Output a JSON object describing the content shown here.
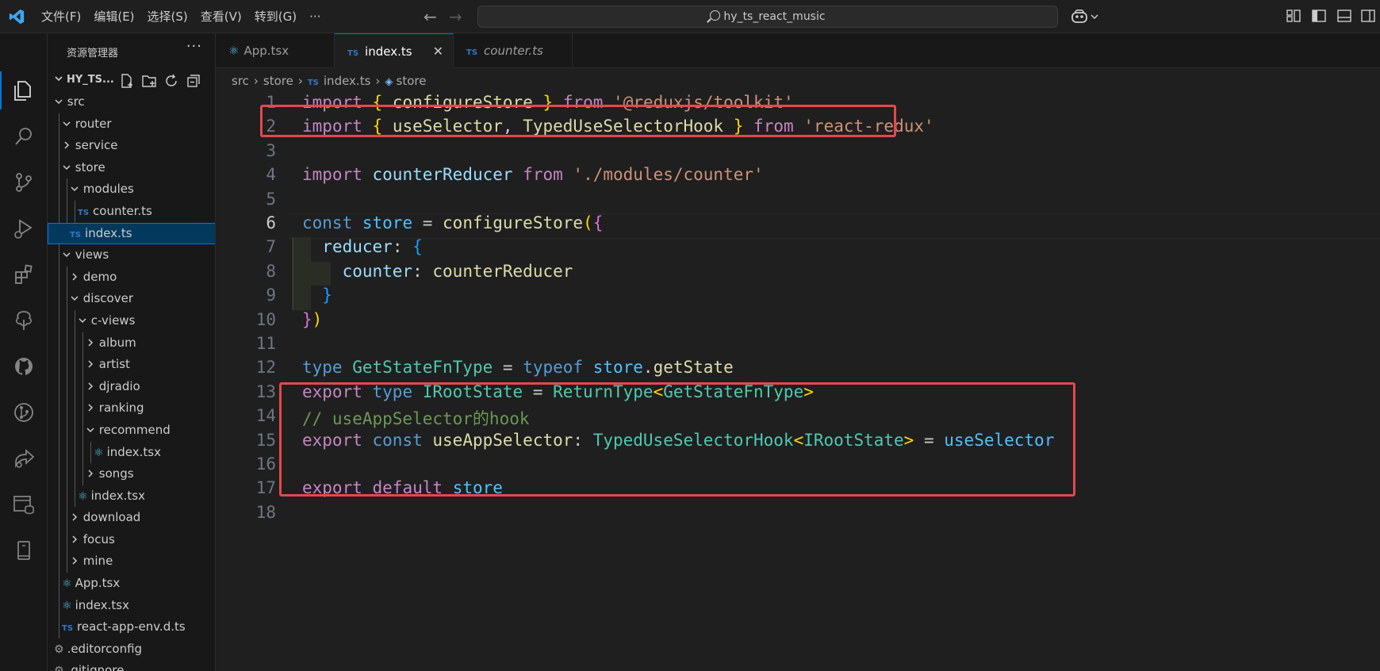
{
  "titlebar": {
    "menu": [
      "文件(F)",
      "编辑(E)",
      "选择(S)",
      "查看(V)",
      "转到(G)",
      "···"
    ],
    "search": "hy_ts_react_music"
  },
  "sidebar": {
    "title": "资源管理器",
    "more": "···",
    "root": "HY_TS...",
    "items": [
      {
        "label": "src",
        "depth": 0,
        "kind": "folder-open"
      },
      {
        "label": "router",
        "depth": 1,
        "kind": "folder-open"
      },
      {
        "label": "service",
        "depth": 1,
        "kind": "folder-closed"
      },
      {
        "label": "store",
        "depth": 1,
        "kind": "folder-open"
      },
      {
        "label": "modules",
        "depth": 2,
        "kind": "folder-open"
      },
      {
        "label": "counter.ts",
        "depth": 3,
        "kind": "ts"
      },
      {
        "label": "index.ts",
        "depth": 2,
        "kind": "ts",
        "selected": true
      },
      {
        "label": "views",
        "depth": 1,
        "kind": "folder-open"
      },
      {
        "label": "demo",
        "depth": 2,
        "kind": "folder-closed"
      },
      {
        "label": "discover",
        "depth": 2,
        "kind": "folder-open"
      },
      {
        "label": "c-views",
        "depth": 3,
        "kind": "folder-open"
      },
      {
        "label": "album",
        "depth": 4,
        "kind": "folder-closed"
      },
      {
        "label": "artist",
        "depth": 4,
        "kind": "folder-closed"
      },
      {
        "label": "djradio",
        "depth": 4,
        "kind": "folder-closed"
      },
      {
        "label": "ranking",
        "depth": 4,
        "kind": "folder-closed"
      },
      {
        "label": "recommend",
        "depth": 4,
        "kind": "folder-open"
      },
      {
        "label": "index.tsx",
        "depth": 5,
        "kind": "react"
      },
      {
        "label": "songs",
        "depth": 4,
        "kind": "folder-closed"
      },
      {
        "label": "index.tsx",
        "depth": 3,
        "kind": "react"
      },
      {
        "label": "download",
        "depth": 2,
        "kind": "folder-closed"
      },
      {
        "label": "focus",
        "depth": 2,
        "kind": "folder-closed"
      },
      {
        "label": "mine",
        "depth": 2,
        "kind": "folder-closed"
      },
      {
        "label": "App.tsx",
        "depth": 1,
        "kind": "react"
      },
      {
        "label": "index.tsx",
        "depth": 1,
        "kind": "react"
      },
      {
        "label": "react-app-env.d.ts",
        "depth": 1,
        "kind": "ts"
      },
      {
        "label": ".editorconfig",
        "depth": 0,
        "kind": "gear"
      },
      {
        "label": ".gitignore",
        "depth": 0,
        "kind": "gear"
      }
    ]
  },
  "tabs": [
    {
      "label": "App.tsx",
      "kind": "react",
      "active": false,
      "italic": false
    },
    {
      "label": "index.ts",
      "kind": "ts",
      "active": true,
      "italic": false,
      "close": "✕"
    },
    {
      "label": "counter.ts",
      "kind": "ts",
      "active": false,
      "italic": true
    }
  ],
  "breadcrumb": [
    "src",
    "store",
    "index.ts",
    "store"
  ],
  "ts_badge": "TS",
  "editor": {
    "current_line": 6,
    "lines": [
      [
        [
          "kw",
          "import"
        ],
        [
          "pl",
          " "
        ],
        [
          "br1",
          "{"
        ],
        [
          "pl",
          " "
        ],
        [
          "fn",
          "configureStore"
        ],
        [
          "pl",
          " "
        ],
        [
          "br1",
          "}"
        ],
        [
          "pl",
          " "
        ],
        [
          "kw",
          "from"
        ],
        [
          "pl",
          " "
        ],
        [
          "str",
          "'@reduxjs/toolkit'"
        ]
      ],
      [
        [
          "kw",
          "import"
        ],
        [
          "pl",
          " "
        ],
        [
          "br1",
          "{"
        ],
        [
          "pl",
          " "
        ],
        [
          "fn",
          "useSelector"
        ],
        [
          "pl",
          ", "
        ],
        [
          "fn",
          "TypedUseSelectorHook"
        ],
        [
          "pl",
          " "
        ],
        [
          "br1",
          "}"
        ],
        [
          "pl",
          " "
        ],
        [
          "kw",
          "from"
        ],
        [
          "pl",
          " "
        ],
        [
          "str",
          "'react-redux'"
        ]
      ],
      [],
      [
        [
          "kw",
          "import"
        ],
        [
          "pl",
          " "
        ],
        [
          "var",
          "counterReducer"
        ],
        [
          "pl",
          " "
        ],
        [
          "kw",
          "from"
        ],
        [
          "pl",
          " "
        ],
        [
          "str",
          "'./modules/counter'"
        ]
      ],
      [],
      [
        [
          "kw2",
          "const"
        ],
        [
          "pl",
          " "
        ],
        [
          "cvar",
          "store"
        ],
        [
          "pl",
          " = "
        ],
        [
          "fn",
          "configureStore"
        ],
        [
          "br1",
          "("
        ],
        [
          "br2",
          "{"
        ]
      ],
      [
        [
          "pl",
          "  "
        ],
        [
          "var",
          "reducer"
        ],
        [
          "pl",
          ": "
        ],
        [
          "br3",
          "{"
        ]
      ],
      [
        [
          "pl",
          "    "
        ],
        [
          "var",
          "counter"
        ],
        [
          "pl",
          ": "
        ],
        [
          "fn",
          "counterReducer"
        ]
      ],
      [
        [
          "pl",
          "  "
        ],
        [
          "br3",
          "}"
        ]
      ],
      [
        [
          "br2",
          "}"
        ],
        [
          "br1",
          ")"
        ]
      ],
      [],
      [
        [
          "kw2",
          "type"
        ],
        [
          "pl",
          " "
        ],
        [
          "ty",
          "GetStateFnType"
        ],
        [
          "pl",
          " = "
        ],
        [
          "kw2",
          "typeof"
        ],
        [
          "pl",
          " "
        ],
        [
          "cvar",
          "store"
        ],
        [
          "pl",
          "."
        ],
        [
          "fn",
          "getState"
        ]
      ],
      [
        [
          "kw",
          "export"
        ],
        [
          "pl",
          " "
        ],
        [
          "kw2",
          "type"
        ],
        [
          "pl",
          " "
        ],
        [
          "ty",
          "IRootState"
        ],
        [
          "pl",
          " = "
        ],
        [
          "ty",
          "ReturnType"
        ],
        [
          "br1",
          "<"
        ],
        [
          "ty",
          "GetStateFnType"
        ],
        [
          "br1",
          ">"
        ]
      ],
      [
        [
          "cm",
          "// useAppSelector的hook"
        ]
      ],
      [
        [
          "kw",
          "export"
        ],
        [
          "pl",
          " "
        ],
        [
          "kw2",
          "const"
        ],
        [
          "pl",
          " "
        ],
        [
          "fn",
          "useAppSelector"
        ],
        [
          "pl",
          ": "
        ],
        [
          "ty",
          "TypedUseSelectorHook"
        ],
        [
          "br1",
          "<"
        ],
        [
          "ty",
          "IRootState"
        ],
        [
          "br1",
          ">"
        ],
        [
          "pl",
          " = "
        ],
        [
          "cvar",
          "useSelector"
        ]
      ],
      [],
      [
        [
          "kw",
          "export"
        ],
        [
          "pl",
          " "
        ],
        [
          "kw",
          "default"
        ],
        [
          "pl",
          " "
        ],
        [
          "cvar",
          "store"
        ]
      ],
      []
    ]
  },
  "colors": {
    "highlight_box": "#e5484d",
    "accent": "#0078d4",
    "selected_row": "#04395e"
  }
}
